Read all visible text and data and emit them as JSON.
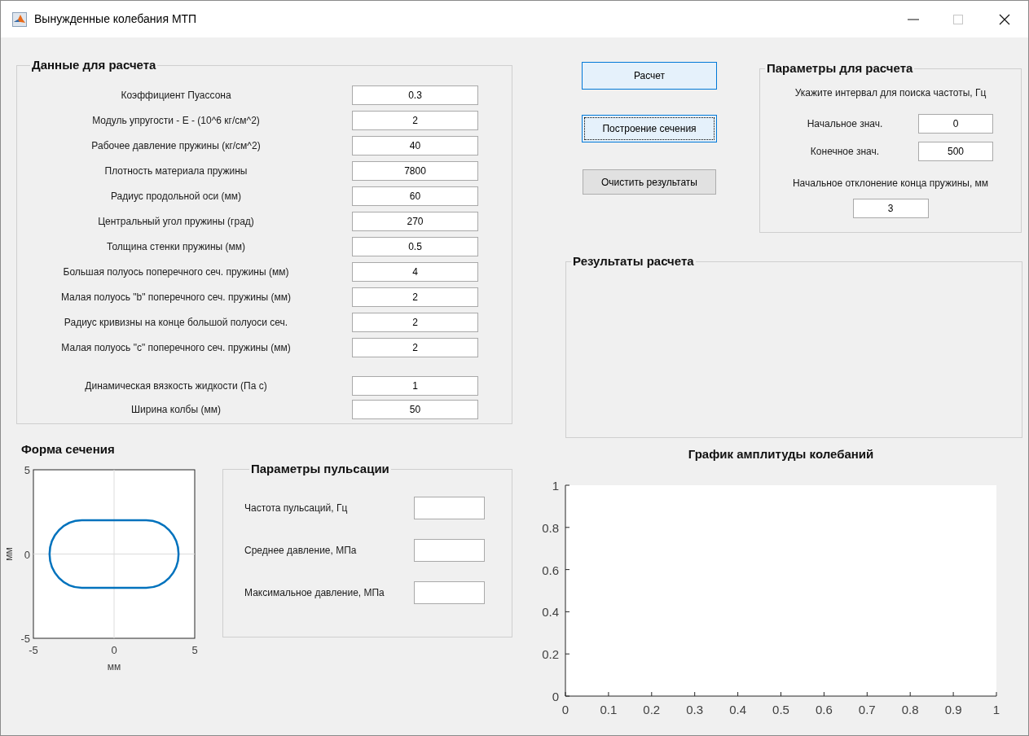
{
  "window": {
    "title": "Вынужденные колебания МТП",
    "maximize_enabled": false
  },
  "data_panel": {
    "title": "Данные для расчета",
    "rows": [
      {
        "label": "Коэффициент Пуассона",
        "value": "0.3"
      },
      {
        "label": "Модуль упругости - Е - (10^6 кг/см^2)",
        "value": "2"
      },
      {
        "label": "Рабочее давление пружины (кг/см^2)",
        "value": "40"
      },
      {
        "label": "Плотность материала пружины",
        "value": "7800"
      },
      {
        "label": "Радиус продольной оси (мм)",
        "value": "60"
      },
      {
        "label": "Центральный угол пружины (град)",
        "value": "270"
      },
      {
        "label": "Толщина стенки пружины (мм)",
        "value": "0.5"
      },
      {
        "label": "Большая полуось поперечного сеч. пружины (мм)",
        "value": "4"
      },
      {
        "label": "Малая полуось \"b\" поперечного сеч. пружины (мм)",
        "value": "2"
      },
      {
        "label": "Радиус кривизны на конце большой полуоси сеч.",
        "value": "2"
      },
      {
        "label": "Малая полуось \"с\" поперечного сеч. пружины (мм)",
        "value": "2"
      }
    ],
    "extra_rows": [
      {
        "label": "Динамическая вязкость жидкости (Па с)",
        "value": "1"
      },
      {
        "label": "Ширина колбы (мм)",
        "value": "50"
      }
    ]
  },
  "section_plot": {
    "title": "Форма сечения",
    "chart_data": {
      "type": "line",
      "xlabel": "мм",
      "ylabel": "мм",
      "xlim": [
        -5,
        5
      ],
      "ylim": [
        -5,
        5
      ],
      "xticks": [
        -5,
        0,
        5
      ],
      "yticks": [
        -5,
        0,
        5
      ]
    }
  },
  "pulse_panel": {
    "title": "Параметры пульсации",
    "rows": [
      {
        "label": "Частота пульсаций, Гц"
      },
      {
        "label": "Среднее давление, МПа"
      },
      {
        "label": "Максимальное давление, МПа"
      }
    ]
  },
  "buttons": [
    {
      "label": "Расчет",
      "highlighted": true,
      "focused": false
    },
    {
      "label": "Построение сечения",
      "highlighted": true,
      "focused": true
    },
    {
      "label": "Очистить результаты",
      "highlighted": false,
      "focused": false
    }
  ],
  "params_panel": {
    "title": "Параметры для расчета",
    "hint": "Укажите интервал для поиска частоты, Гц",
    "rows": [
      {
        "label": "Начальное знач.",
        "value": "0"
      },
      {
        "label": "Конечное знач.",
        "value": "500"
      }
    ],
    "deviation": {
      "label": "Начальное отклонение конца пружины, мм",
      "value": "3"
    }
  },
  "results_panel": {
    "title": "Результаты расчета"
  },
  "amplitude_plot": {
    "chart_data": {
      "type": "line",
      "title": "График амплитуды колебаний",
      "xlim": [
        0,
        1
      ],
      "ylim": [
        0,
        1
      ],
      "xticks": [
        {
          "value": 0,
          "label": "0"
        },
        {
          "value": 0.1,
          "label": "0.1"
        },
        {
          "value": 0.2,
          "label": "0.2"
        },
        {
          "value": 0.3,
          "label": "0.3"
        },
        {
          "value": 0.4,
          "label": "0.4"
        },
        {
          "value": 0.5,
          "label": "0.5"
        },
        {
          "value": 0.6,
          "label": "0.6"
        },
        {
          "value": 0.7,
          "label": "0.7"
        },
        {
          "value": 0.8,
          "label": "0.8"
        },
        {
          "value": 0.9,
          "label": "0.9"
        },
        {
          "value": 1,
          "label": "1"
        }
      ],
      "yticks": [
        {
          "value": 0,
          "label": "0"
        },
        {
          "value": 0.2,
          "label": "0.2"
        },
        {
          "value": 0.4,
          "label": "0.4"
        },
        {
          "value": 0.6,
          "label": "0.6"
        },
        {
          "value": 0.8,
          "label": "0.8"
        },
        {
          "value": 1,
          "label": "1"
        }
      ]
    }
  }
}
